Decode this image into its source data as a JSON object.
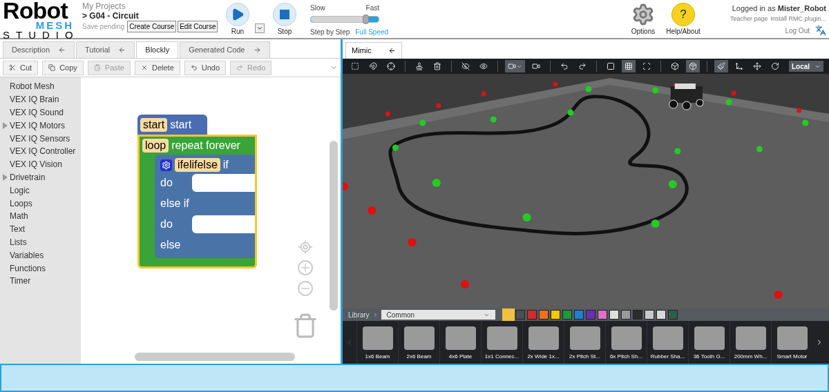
{
  "logo": {
    "word_top": "Robot",
    "word_mid": "MESH",
    "word_bottom": "STUDIO"
  },
  "project": {
    "breadcrumb": "My Projects",
    "name": "> G04 - Circuit",
    "status": "Save pending",
    "buttons": [
      "Create Course",
      "Edit Course"
    ]
  },
  "run": {
    "run_label": "Run",
    "stop_label": "Stop"
  },
  "speed": {
    "slow": "Slow",
    "fast": "Fast",
    "left_label": "Step by Step",
    "right_label": "Full Speed",
    "level": 0.82
  },
  "account": {
    "options": "Options",
    "help": "Help/About",
    "help_glyph": "?",
    "logged_in": "Logged in as **Mister_Robot**",
    "links": [
      "Teacher page",
      "Install RMC plugin..."
    ],
    "logout": "Log Out"
  },
  "left_tabs": [
    {
      "label": "Description",
      "selected": false,
      "arrow_left": true,
      "arrow_right": false
    },
    {
      "label": "Tutorial",
      "selected": false,
      "arrow_left": true,
      "arrow_right": false
    },
    {
      "label": "Blockly",
      "selected": true,
      "arrow_left": false,
      "arrow_right": false
    },
    {
      "label": "Generated Code",
      "selected": false,
      "arrow_left": false,
      "arrow_right": true
    }
  ],
  "edit_buttons": [
    {
      "kind": "cut",
      "label": "Cut",
      "disabled": false
    },
    {
      "kind": "copy",
      "label": "Copy",
      "disabled": false
    },
    {
      "kind": "paste",
      "label": "Paste",
      "disabled": true
    },
    {
      "kind": "delete",
      "label": "Delete",
      "disabled": false
    },
    {
      "kind": "undo",
      "label": "Undo",
      "disabled": false
    },
    {
      "kind": "redo",
      "label": "Redo",
      "disabled": true
    }
  ],
  "toolbox": [
    {
      "label": "Robot Mesh",
      "expandable": false
    },
    {
      "label": "VEX IQ Brain",
      "expandable": false
    },
    {
      "label": "VEX IQ Sound",
      "expandable": false
    },
    {
      "label": "VEX IQ Motors",
      "expandable": true
    },
    {
      "label": "VEX IQ Sensors",
      "expandable": false
    },
    {
      "label": "VEX IQ Controller",
      "expandable": false
    },
    {
      "label": "VEX IQ Vision",
      "expandable": false
    },
    {
      "label": "Drivetrain",
      "expandable": true
    },
    {
      "label": "Logic",
      "expandable": false
    },
    {
      "label": "Loops",
      "expandable": false
    },
    {
      "label": "Math",
      "expandable": false
    },
    {
      "label": "Text",
      "expandable": false
    },
    {
      "label": "Lists",
      "expandable": false
    },
    {
      "label": "Variables",
      "expandable": false
    },
    {
      "label": "Functions",
      "expandable": false
    },
    {
      "label": "Timer",
      "expandable": false
    }
  ],
  "blocks": {
    "start": {
      "tag": "start",
      "text": "start"
    },
    "loop": {
      "tag": "loop",
      "text": "repeat forever"
    },
    "if": {
      "tag": "ifelifelse",
      "lines": [
        "if",
        "do",
        "else if",
        "do",
        "else"
      ]
    }
  },
  "mimic_tab": {
    "label": "Mimic",
    "selected": true
  },
  "tool_groups": [
    [
      {
        "kind": "select",
        "active": false
      },
      {
        "kind": "magnet",
        "active": false
      },
      {
        "kind": "target",
        "active": false
      }
    ],
    [
      {
        "kind": "stamp",
        "active": false
      },
      {
        "kind": "trash",
        "active": false
      }
    ],
    [
      {
        "kind": "hide",
        "active": false
      },
      {
        "kind": "show",
        "active": false
      }
    ],
    [
      {
        "kind": "camera-menu",
        "active": true
      },
      {
        "kind": "camera",
        "active": false
      }
    ],
    [
      {
        "kind": "undo",
        "active": false
      },
      {
        "kind": "redo",
        "active": false
      }
    ],
    [
      {
        "kind": "solid",
        "active": false
      },
      {
        "kind": "grid",
        "active": true
      },
      {
        "kind": "frame",
        "active": false
      }
    ],
    [
      {
        "kind": "cube",
        "active": false
      },
      {
        "kind": "cube-shaded",
        "active": true
      }
    ],
    [
      {
        "kind": "paint",
        "active": true
      },
      {
        "kind": "move3d",
        "active": false
      },
      {
        "kind": "move",
        "active": false
      },
      {
        "kind": "rotate",
        "active": false
      }
    ]
  ],
  "space": "Local",
  "library": {
    "label": "Library",
    "category": "Common",
    "swatches": [
      {
        "color": "#f0c040",
        "selected": true
      },
      {
        "color": "#4a4f54",
        "selected": false
      },
      {
        "color": "#d42b2b",
        "selected": false
      },
      {
        "color": "#f07020",
        "selected": false
      },
      {
        "color": "#f5c800",
        "selected": false
      },
      {
        "color": "#1d9a3a",
        "selected": false
      },
      {
        "color": "#1f7fd0",
        "selected": false
      },
      {
        "color": "#6a2fb0",
        "selected": false
      },
      {
        "color": "#e070c0",
        "selected": false
      },
      {
        "color": "#e0e0da",
        "selected": false
      },
      {
        "color": "#9a9a9a",
        "selected": false
      },
      {
        "color": "#2a2c2e",
        "selected": false
      },
      {
        "color": "#c8c8c8",
        "selected": false
      },
      {
        "color": "#d8d8d8",
        "selected": false
      },
      {
        "color": "#2e5e48",
        "selected": false
      }
    ]
  },
  "parts": [
    {
      "label": "1x6 Beam"
    },
    {
      "label": "2x6 Beam"
    },
    {
      "label": "4x6 Plate"
    },
    {
      "label": "1x1 Connec..."
    },
    {
      "label": "2x Wide 1x..."
    },
    {
      "label": "2x Pitch St..."
    },
    {
      "label": "6x Pitch Sh..."
    },
    {
      "label": "Rubber Sha..."
    },
    {
      "label": "36 Tooth G..."
    },
    {
      "label": "200mm Wh..."
    },
    {
      "label": "Smart Motor"
    }
  ]
}
